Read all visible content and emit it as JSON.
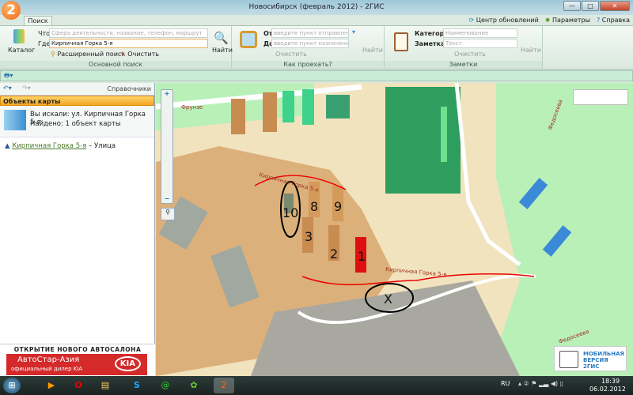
{
  "window": {
    "title": "Новосибирск (февраль 2012) - 2ГИС",
    "logo": "2",
    "min": "—",
    "max": "□",
    "close": "✕"
  },
  "tabs": [
    {
      "label": "Поиск"
    }
  ],
  "top_links": [
    {
      "label": "Центр обновлений",
      "icon": "refresh-icon"
    },
    {
      "label": "Параметры",
      "icon": "gear-icon"
    },
    {
      "label": "Справка",
      "icon": "help-icon"
    }
  ],
  "search": {
    "catalog_label": "Каталог",
    "what_label": "Что",
    "what_placeholder": "Сфера деятельности, название, телефон, маршрут",
    "where_label": "Где",
    "where_value": "Кирпичная Горка 5-я",
    "find_label": "Найти",
    "advanced_label": "Расширенный поиск",
    "clear_label": "Очистить",
    "group_label": "Основной поиск"
  },
  "route": {
    "from_label": "От",
    "from_placeholder": "введите пункт отправления",
    "to_label": "До",
    "to_placeholder": "введите пункт назначения",
    "clear_label": "Очистить",
    "find_label": "Найти",
    "group_label": "Как проехать?"
  },
  "notes": {
    "category_label": "Категория",
    "category_placeholder": "Наименование",
    "note_label": "Заметка",
    "note_placeholder": "Текст",
    "clear_label": "Очистить",
    "find_label": "Найти",
    "group_label": "Заметки"
  },
  "left": {
    "directories_label": "Справочники",
    "header": "Объекты карты",
    "searched": "Вы искали: ул. Кирпичная Горка 5-я",
    "found": "Найдено: 1 объект карты",
    "result_link": "Кирпичная Горка 5-я",
    "result_type": "– Улица"
  },
  "ad": {
    "top": "ОТКРЫТИЕ НОВОГО АВТОСАЛОНА",
    "brand": "АвтоСтар-Азия",
    "sub": "официальный дилер KIA",
    "logo": "KIA"
  },
  "map": {
    "streets": [
      "Фрунзе",
      "Кирпичная Горка 5-я",
      "Кирпичная Горка 5-я",
      "Федосеева",
      "Федосеева"
    ],
    "marks": [
      "10",
      "8",
      "9",
      "3",
      "2",
      "1",
      "X"
    ],
    "mobile_badge_1": "МОБИЛЬНАЯ",
    "mobile_badge_2": "ВЕРСИЯ 2ГИС"
  },
  "taskbar": {
    "lang": "RU",
    "time": "18:39",
    "date": "06.02.2012"
  }
}
